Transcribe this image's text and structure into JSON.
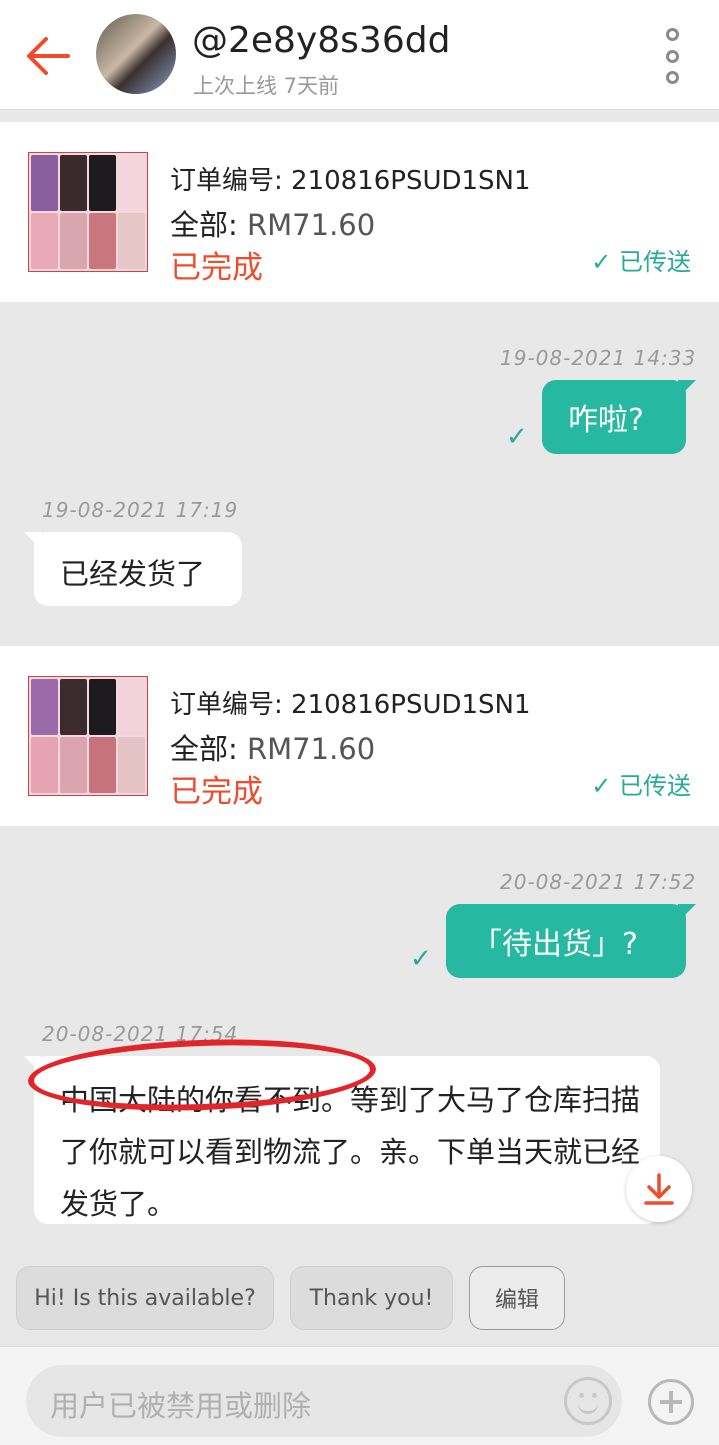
{
  "header": {
    "username": "@2e8y8s36dd",
    "status": "上次上线 7天前"
  },
  "orders": [
    {
      "order_number_label": "订单编号: 210816PSUD1SN1",
      "total_label": "全部: ",
      "total_amount": "RM71.60",
      "status": "已完成",
      "delivery_status": "已传送"
    },
    {
      "order_number_label": "订单编号: 210816PSUD1SN1",
      "total_label": "全部: ",
      "total_amount": "RM71.60",
      "status": "已完成",
      "delivery_status": "已传送"
    }
  ],
  "messages": [
    {
      "direction": "out",
      "timestamp": "19-08-2021 14:33",
      "text": "咋啦?"
    },
    {
      "direction": "in",
      "timestamp": "19-08-2021 17:19",
      "text": "已经发货了"
    },
    {
      "direction": "out",
      "timestamp": "20-08-2021 17:52",
      "text": "「待出货」?"
    },
    {
      "direction": "in",
      "timestamp": "20-08-2021 17:54",
      "text": "中国大陆的你看不到。等到了大马了仓库扫描了你就可以看到物流了。亲。下单当天就已经发货了。"
    }
  ],
  "quick_replies": [
    "Hi! Is this available?",
    "Thank you!",
    "编辑"
  ],
  "input": {
    "placeholder": "用户已被禁用或删除"
  },
  "colors": {
    "accent": "#ee4d2d",
    "sent_bubble": "#26b8a0",
    "check": "#26aa99",
    "annotation": "#e1262b"
  }
}
